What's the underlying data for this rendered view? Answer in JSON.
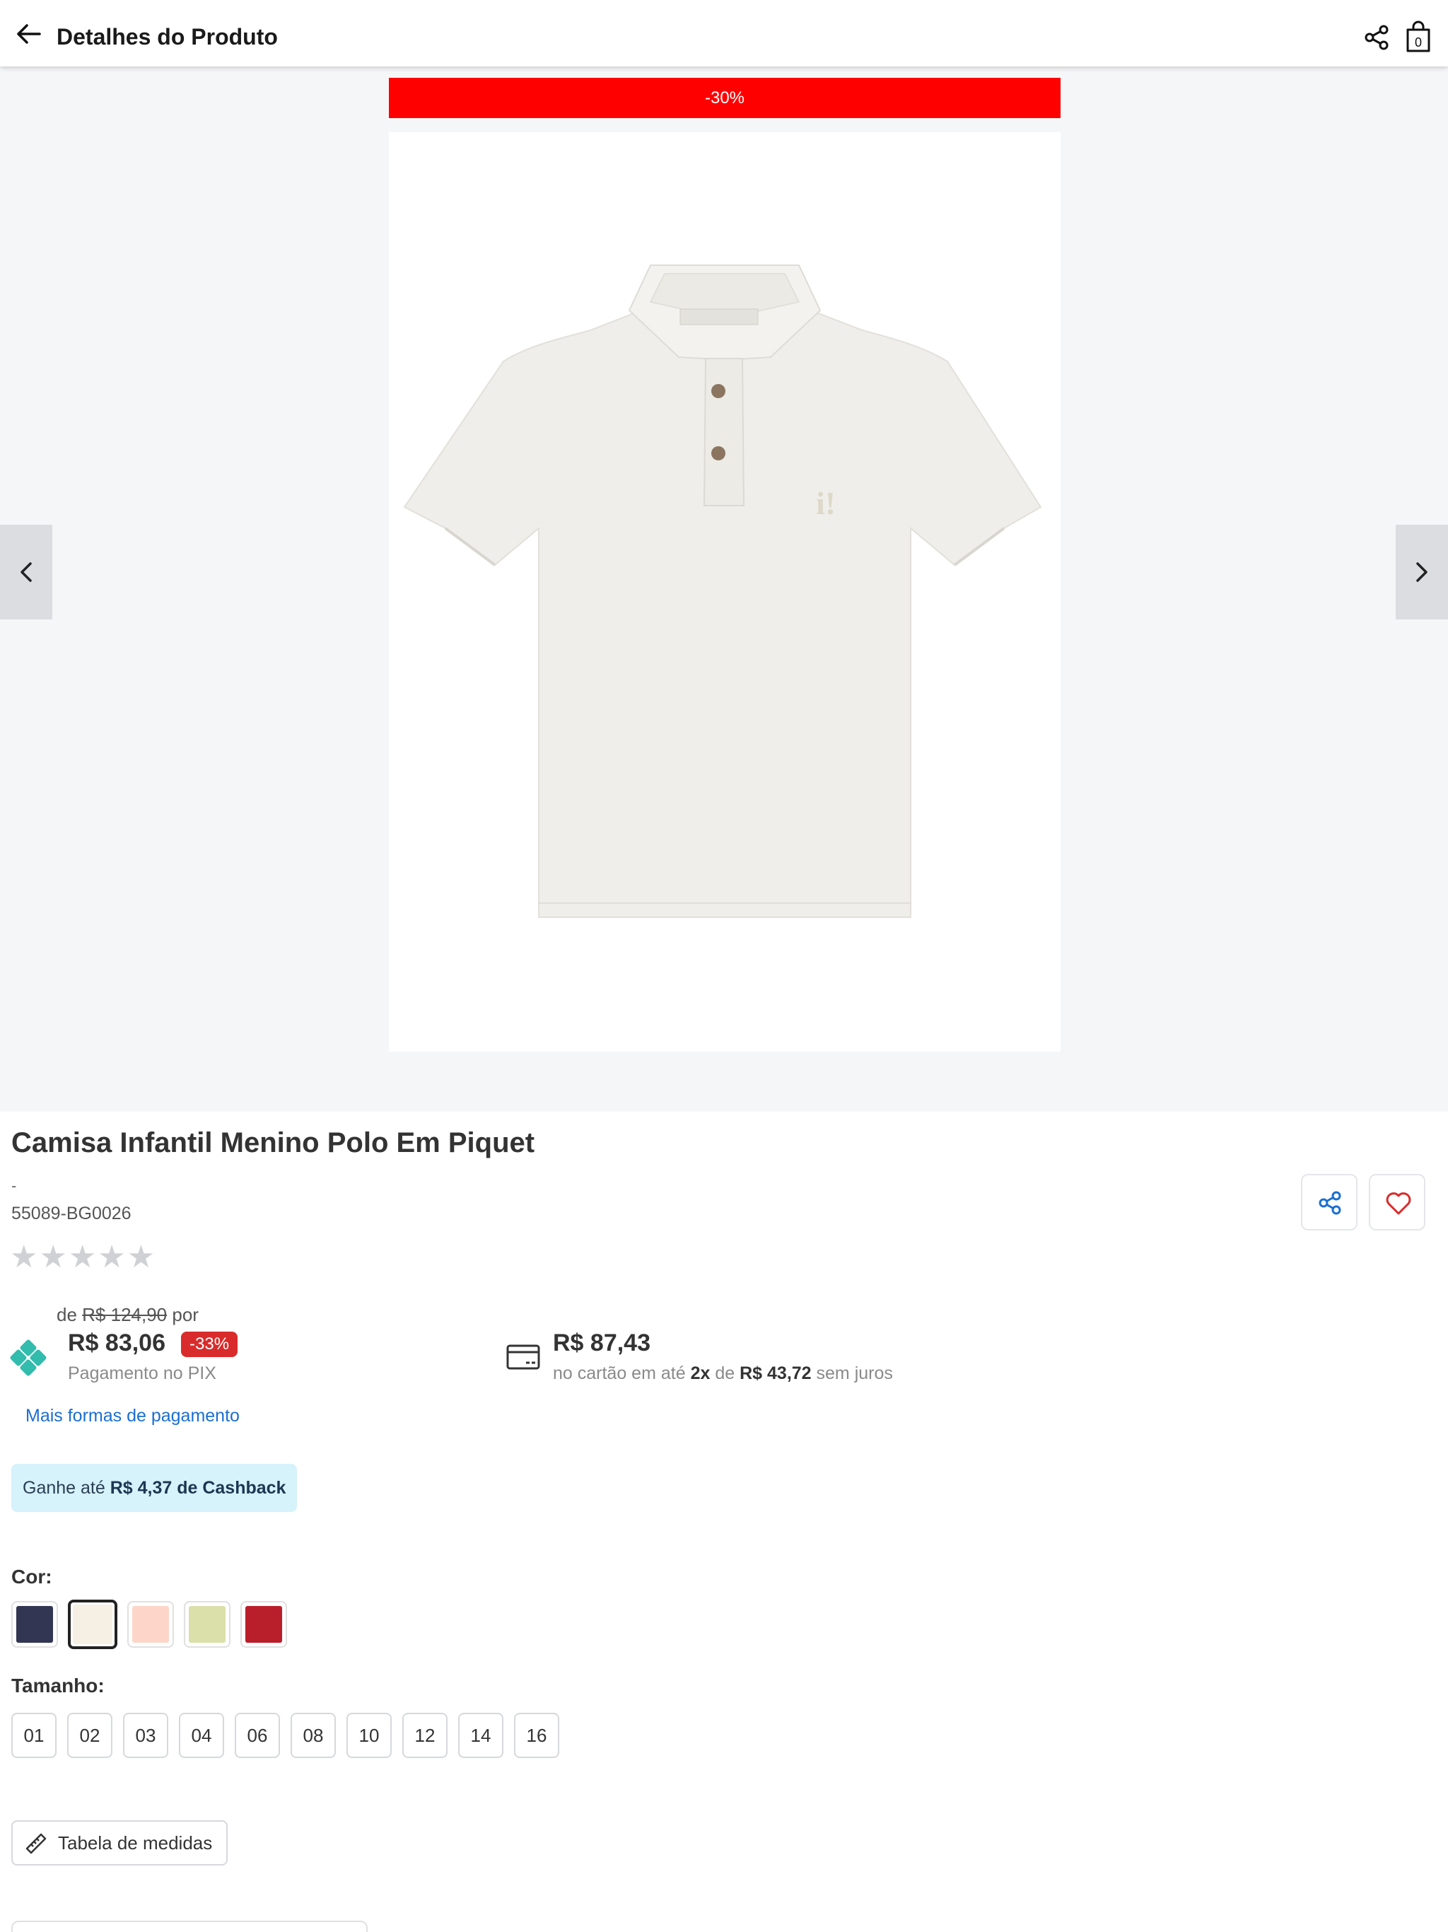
{
  "header": {
    "title": "Detalhes do Produto",
    "back_icon": "arrow-left-icon",
    "share_icon": "share-icon",
    "bag_icon": "shopping-bag-icon",
    "bag_count": "0"
  },
  "gallery": {
    "discount_banner": "-30%",
    "banner_color": "#ff0000",
    "prev_icon": "chevron-left-icon",
    "next_icon": "chevron-right-icon",
    "image_subject": "white polo shirt"
  },
  "product": {
    "title": "Camisa Infantil Menino Polo Em Piquet",
    "dash": "-",
    "sku": "55089-BG0026",
    "stars": "★★★★★",
    "rating_out_of_5": 0
  },
  "pricing": {
    "from_prefix": "de",
    "old_price": "R$ 124,90",
    "from_suffix": "por",
    "pix_price": "R$ 83,06",
    "pix_discount": "-33%",
    "pix_label": "Pagamento no PIX",
    "card_price": "R$ 87,43",
    "card_text_1": "no cartão em até",
    "card_installments": "2x",
    "card_text_2": "de",
    "card_installment_value": "R$ 43,72",
    "card_text_3": "sem juros",
    "more_payment": "Mais formas de pagamento"
  },
  "cashback": {
    "prefix": "Ganhe até",
    "amount": "R$ 4,37 de Cashback"
  },
  "color": {
    "label": "Cor:",
    "swatches": [
      "#333652",
      "#f6f0e4",
      "#fdd6c9",
      "#dbe0aa",
      "#b91f2a"
    ],
    "selected_index": 1
  },
  "size": {
    "label": "Tamanho:",
    "options": [
      "01",
      "02",
      "03",
      "04",
      "06",
      "08",
      "10",
      "12",
      "14",
      "16"
    ]
  },
  "measures": {
    "label": "Tabela de medidas",
    "icon": "ruler-icon"
  },
  "accent": "#1a6fd1"
}
